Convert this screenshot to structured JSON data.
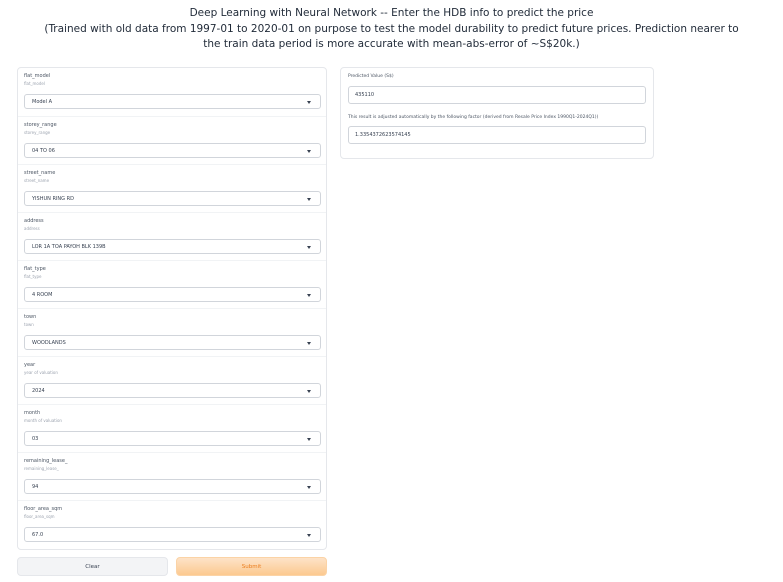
{
  "page": {
    "title_lines": [
      "Deep Learning with Neural Network -- Enter the HDB info to predict the price",
      "(Trained with old data from 1997-01 to 2020-01 on purpose to test the model durability to predict future prices. Prediction nearer to",
      "the train data period is more accurate with mean-abs-error of ~S$20k.)"
    ]
  },
  "form": {
    "fields": [
      {
        "label": "flat_model",
        "info": "flat_model",
        "value": "Model A"
      },
      {
        "label": "storey_range",
        "info": "storey_range",
        "value": "04 TO 06"
      },
      {
        "label": "street_name",
        "info": "street_name",
        "value": "YISHUN RING RD"
      },
      {
        "label": "address",
        "info": "address",
        "value": "LOR 1A TOA PAYOH BLK 139B"
      },
      {
        "label": "flat_type",
        "info": "flat_type",
        "value": "4 ROOM"
      },
      {
        "label": "town",
        "info": "town",
        "value": "WOODLANDS"
      },
      {
        "label": "year",
        "info": "year of valuation",
        "value": "2024"
      },
      {
        "label": "month",
        "info": "month of valuation",
        "value": "03"
      },
      {
        "label": "remaining_lease_",
        "info": "remaining_lease_",
        "value": "94"
      },
      {
        "label": "floor_area_sqm",
        "info": "floor_area_sqm",
        "value": "67.0"
      }
    ],
    "clear_label": "Clear",
    "submit_label": "Submit"
  },
  "output": {
    "predicted_label": "Predicted Value (S$)",
    "predicted_value": "435110",
    "factor_label": "This result is adjusted automatically by the following factor (derived from Resale Price Index 1990Q1-2024Q1))",
    "factor_value": "1.3354372623574145"
  },
  "colors": {
    "submit_text": "#ea7c1c",
    "submit_bg": "#fcc98f"
  }
}
